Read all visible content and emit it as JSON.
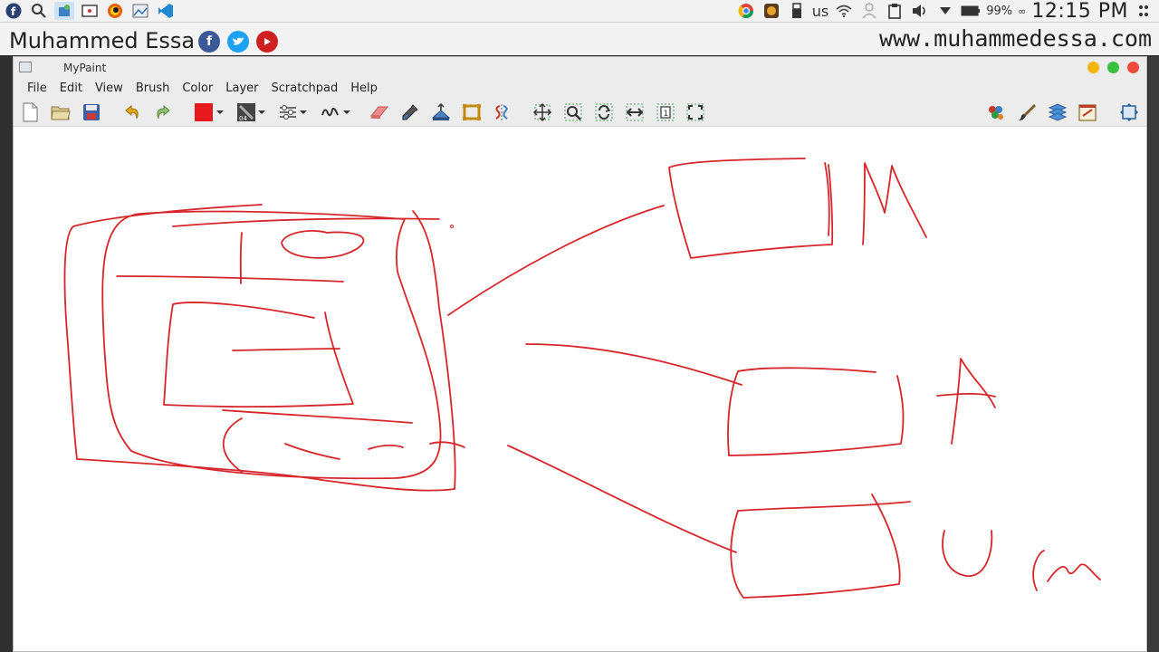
{
  "system_bar": {
    "keyboard_layout": "us",
    "battery_percent": "99%",
    "clock": "12:15 PM",
    "icons": [
      "fedora-icon",
      "search-icon",
      "software-icon",
      "screenshot-icon",
      "firefox-icon",
      "image-viewer-icon",
      "vscode-icon"
    ]
  },
  "banner": {
    "author": "Muhammed Essa",
    "site_url": "www.muhammedessa.com"
  },
  "window": {
    "title": "MyPaint",
    "menu": [
      "File",
      "Edit",
      "View",
      "Brush",
      "Color",
      "Layer",
      "Scratchpad",
      "Help"
    ]
  },
  "colors": {
    "brush": "#e8181f",
    "ink": "#d7262b",
    "close": "#f04a3c",
    "minimize": "#f5b50e",
    "maximize": "#3ac03f"
  }
}
